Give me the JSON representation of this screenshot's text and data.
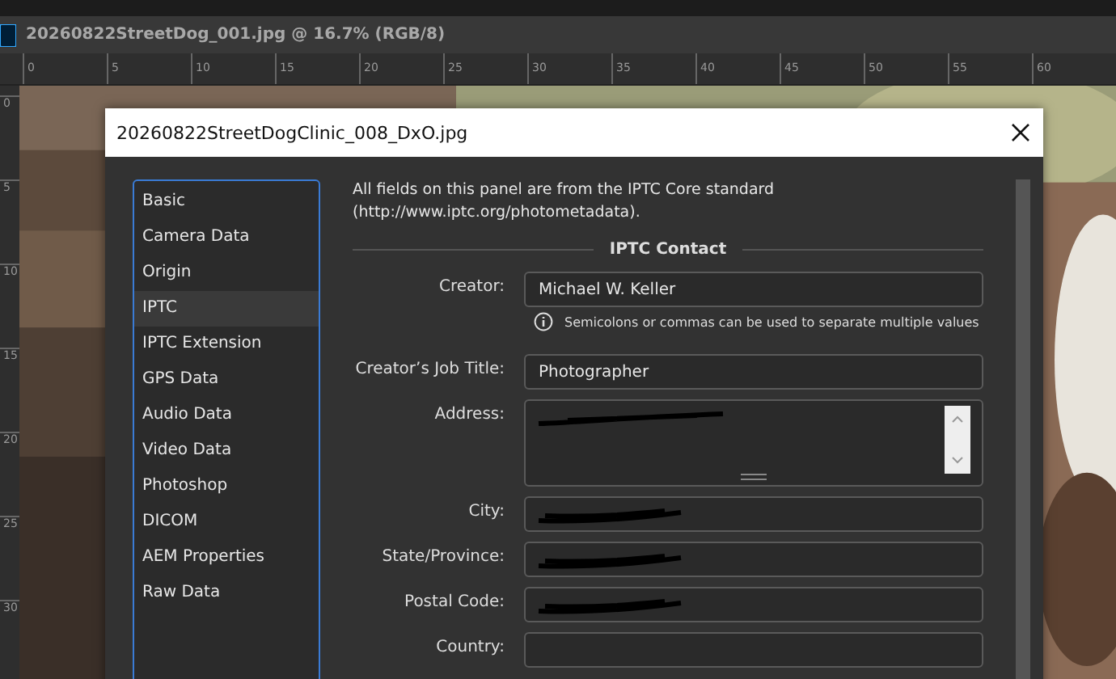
{
  "document_tab": {
    "title": "20260822StreetDog_001.jpg @ 16.7% (RGB/8)"
  },
  "ruler": {
    "top_labels": [
      "0",
      "5",
      "10",
      "15",
      "20",
      "25",
      "30",
      "35",
      "40",
      "45",
      "50",
      "55",
      "60"
    ],
    "left_labels": [
      "0",
      "5",
      "10",
      "15",
      "20",
      "25",
      "30"
    ]
  },
  "dialog": {
    "title": "20260822StreetDogClinic_008_DxO.jpg",
    "sidebar": {
      "items": [
        {
          "label": "Basic",
          "selected": false
        },
        {
          "label": "Camera Data",
          "selected": false
        },
        {
          "label": "Origin",
          "selected": false
        },
        {
          "label": "IPTC",
          "selected": true
        },
        {
          "label": "IPTC Extension",
          "selected": false
        },
        {
          "label": "GPS Data",
          "selected": false
        },
        {
          "label": "Audio Data",
          "selected": false
        },
        {
          "label": "Video Data",
          "selected": false
        },
        {
          "label": "Photoshop",
          "selected": false
        },
        {
          "label": "DICOM",
          "selected": false
        },
        {
          "label": "AEM Properties",
          "selected": false
        },
        {
          "label": "Raw Data",
          "selected": false
        }
      ]
    },
    "intro": "All fields on this panel are from the IPTC Core standard (http://www.iptc.org/photometadata).",
    "section": "IPTC Contact",
    "fields": [
      {
        "label": "Creator:",
        "kind": "text",
        "value": "Michael W. Keller",
        "hint": "Semicolons or commas can be used to separate multiple values",
        "redacted": false
      },
      {
        "label": "Creator’s Job Title:",
        "kind": "text",
        "value": "Photographer",
        "redacted": false
      },
      {
        "label": "Address:",
        "kind": "textarea",
        "redacted": true
      },
      {
        "label": "City:",
        "kind": "text",
        "redacted": true
      },
      {
        "label": "State/Province:",
        "kind": "text",
        "redacted": true
      },
      {
        "label": "Postal Code:",
        "kind": "text",
        "redacted": true
      },
      {
        "label": "Country:",
        "kind": "text",
        "redacted": false
      }
    ]
  }
}
